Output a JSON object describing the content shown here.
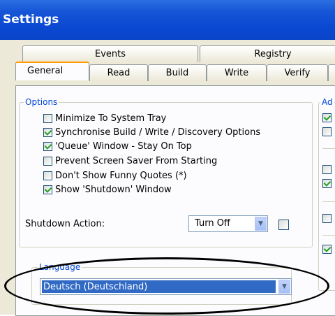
{
  "window": {
    "title": "Settings"
  },
  "tabs": {
    "row1": [
      "Events",
      "Registry"
    ],
    "row2": [
      "General",
      "Read",
      "Build",
      "Write",
      "Verify"
    ],
    "active": "General"
  },
  "options_group": {
    "legend": "Options",
    "items": [
      {
        "label": "Minimize To System Tray",
        "checked": false
      },
      {
        "label": "Synchronise Build / Write / Discovery Options",
        "checked": true
      },
      {
        "label": "'Queue' Window - Stay On Top",
        "checked": true
      },
      {
        "label": "Prevent Screen Saver From Starting",
        "checked": false
      },
      {
        "label": "Don't Show Funny Quotes (*)",
        "checked": false
      },
      {
        "label": "Show 'Shutdown' Window",
        "checked": true
      }
    ],
    "shutdown_label": "Shutdown Action:",
    "shutdown_value": "Turn Off",
    "shutdown_checkbox_checked": false
  },
  "language_group": {
    "legend": "Language",
    "value": "Deutsch (Deutschland)"
  },
  "right_group": {
    "legend": "Ad",
    "checkboxes": [
      true,
      false,
      false,
      true,
      false,
      true
    ]
  }
}
